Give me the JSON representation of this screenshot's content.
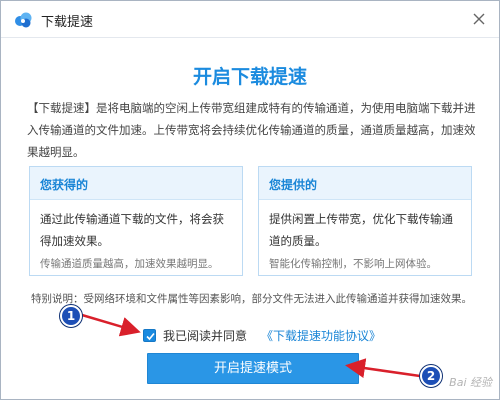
{
  "window": {
    "title": "下载提速"
  },
  "colors": {
    "accent": "#1b8bdf",
    "button": "#2a96e6",
    "card_header_bg": "#eaf4fd",
    "annotation": "#1d4fb6",
    "arrow": "#d9202b"
  },
  "icons": {
    "app": "baidu-netdisk-cloud-icon",
    "close": "close-icon",
    "check": "check-icon"
  },
  "headline": "开启下载提速",
  "description": "【下载提速】是将电脑端的空闲上传带宽组建成特有的传输通道，为使用电脑端下载并进入传输通道的文件加速。上传带宽将会持续优化传输通道的质量，通道质量越高，加速效果越明显。",
  "cards": {
    "gain": {
      "title": "您获得的",
      "body": "通过此传输通道下载的文件，将会获得加速效果。",
      "note": "传输通道质量越高，加速效果越明显。"
    },
    "provide": {
      "title": "您提供的",
      "body": "提供闲置上传带宽，优化下载传输通道的质量。",
      "note": "智能化传输控制，不影响上网体验。"
    }
  },
  "special_note": "特别说明：受网络环境和文件属性等因素影响，部分文件无法进入此传输通道并获得加速效果。",
  "agreement": {
    "checked": true,
    "text": "我已阅读并同意",
    "link": "《下载提速功能协议》"
  },
  "primary_button": "开启提速模式",
  "annotations": [
    "1",
    "2"
  ],
  "watermark": "Bai 经验"
}
